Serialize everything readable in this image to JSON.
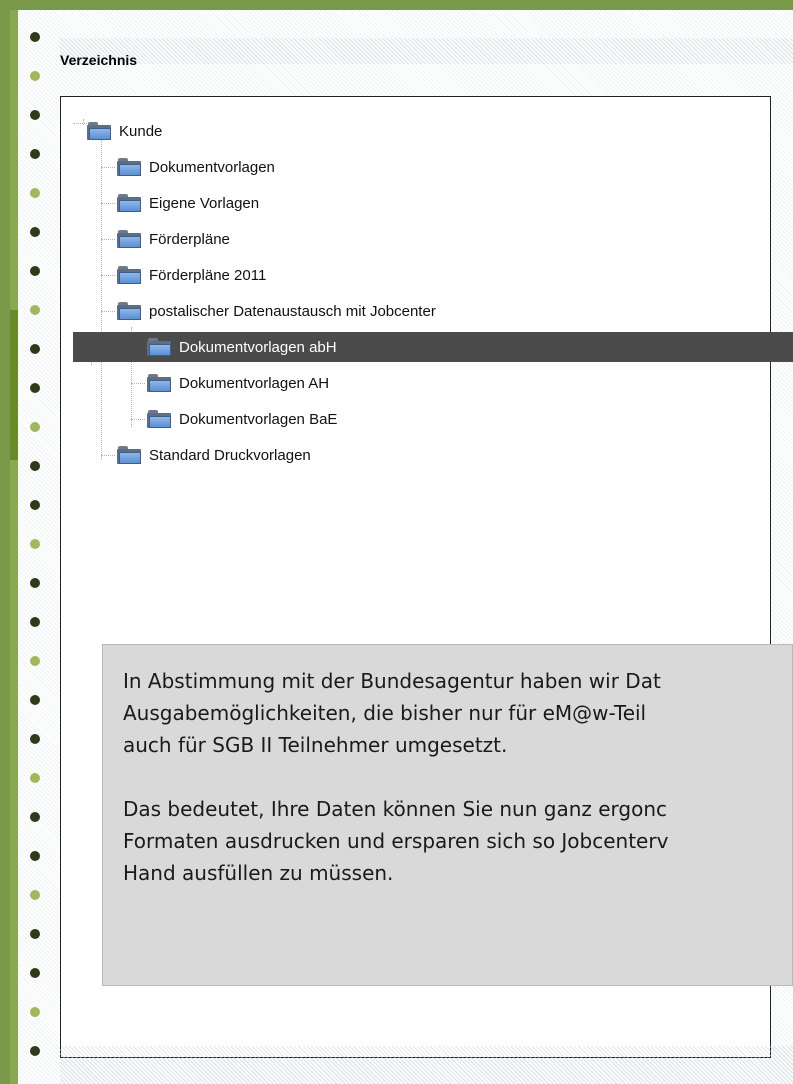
{
  "section": {
    "title": "Verzeichnis"
  },
  "tree": {
    "items": [
      {
        "label": "Kunde",
        "level": 0,
        "selected": false
      },
      {
        "label": "Dokumentvorlagen",
        "level": 1,
        "selected": false
      },
      {
        "label": "Eigene Vorlagen",
        "level": 1,
        "selected": false
      },
      {
        "label": "Förderpläne",
        "level": 1,
        "selected": false
      },
      {
        "label": "Förderpläne 2011",
        "level": 1,
        "selected": false
      },
      {
        "label": "postalischer Datenaustausch mit Jobcenter",
        "level": 1,
        "selected": false
      },
      {
        "label": "Dokumentvorlagen abH",
        "level": 2,
        "selected": true
      },
      {
        "label": "Dokumentvorlagen AH",
        "level": 2,
        "selected": false
      },
      {
        "label": "Dokumentvorlagen BaE",
        "level": 2,
        "selected": false
      },
      {
        "label": "Standard Druckvorlagen",
        "level": 1,
        "selected": false
      }
    ]
  },
  "info": {
    "paragraph1": [
      "In Abstimmung mit der Bundesagentur haben wir Dat",
      "Ausgabemöglichkeiten, die bisher nur für eM@w-Teil",
      "auch für SGB II Teilnehmer umgesetzt."
    ],
    "paragraph2": [
      "Das bedeutet, Ihre Daten können Sie nun ganz ergonc",
      "Formaten ausdrucken und ersparen sich so Jobcenterv",
      "Hand ausfüllen zu müssen."
    ]
  },
  "colors": {
    "selection_bg": "#4b4b4b",
    "folder_blue": "#5c8fd4",
    "info_bg": "#d9d9d9",
    "rail_green": "#8aa84e"
  },
  "icons": {
    "folder": "folder-icon",
    "bullet": "bullet-icon"
  }
}
